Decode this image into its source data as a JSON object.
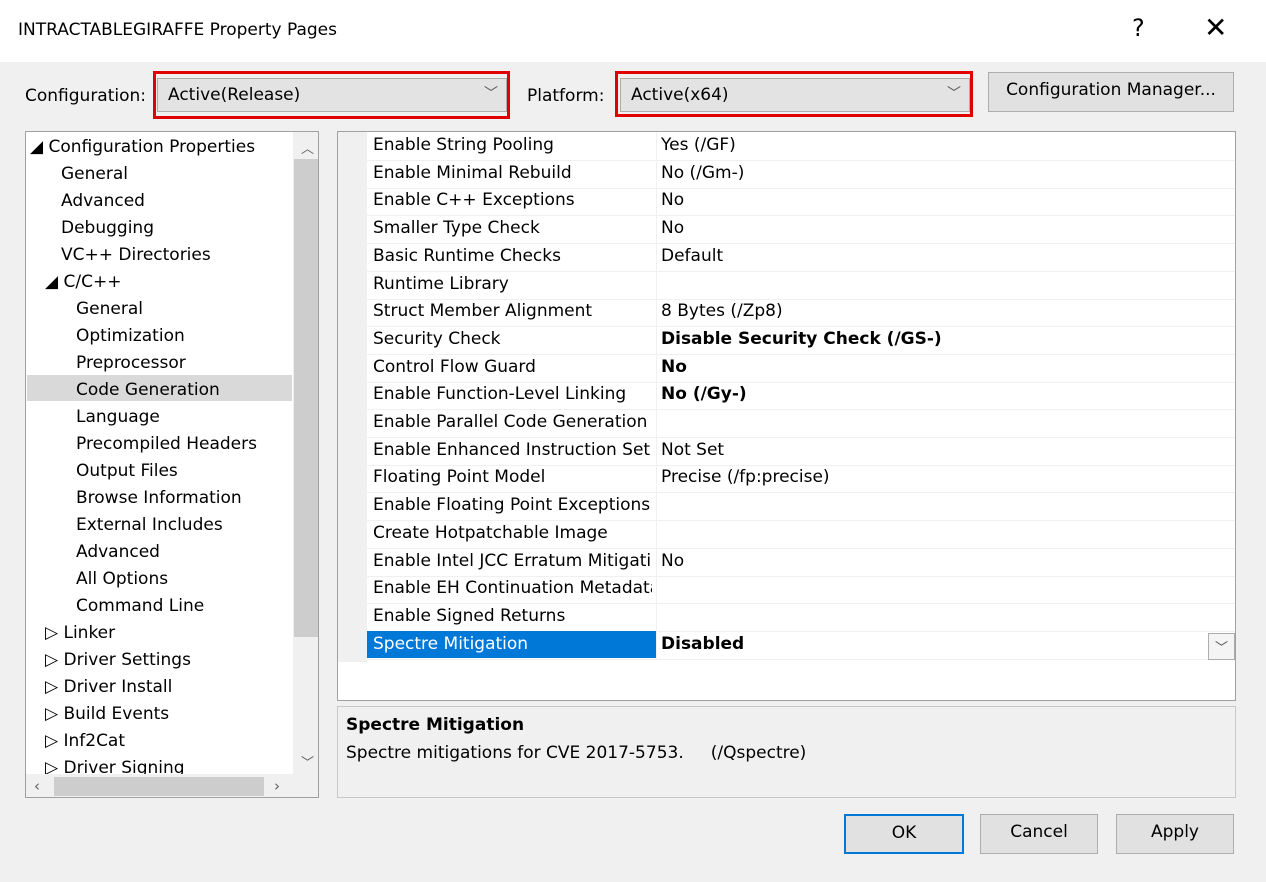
{
  "window": {
    "title": "INTRACTABLEGIRAFFE Property Pages",
    "help_glyph": "?",
    "close_glyph": "✕"
  },
  "toolbar": {
    "configuration_label": "Configuration:",
    "configuration_value": "Active(Release)",
    "platform_label": "Platform:",
    "platform_value": "Active(x64)",
    "configuration_manager_label": "Configuration Manager...",
    "highlight_color": "#e00000"
  },
  "tree": {
    "root": "◢ Configuration Properties",
    "items": [
      "General",
      "Advanced",
      "Debugging",
      "VC++ Directories"
    ],
    "cpp_node": "◢ C/C++",
    "cpp_items": [
      "General",
      "Optimization",
      "Preprocessor",
      "Code Generation",
      "Language",
      "Precompiled Headers",
      "Output Files",
      "Browse Information",
      "External Includes",
      "Advanced",
      "All Options",
      "Command Line"
    ],
    "selected": "Code Generation",
    "collapsed": [
      "▷ Linker",
      "▷ Driver Settings",
      "▷ Driver Install",
      "▷ Build Events",
      "▷ Inf2Cat",
      "▷ Driver Signing"
    ]
  },
  "properties": [
    {
      "name": "Enable String Pooling",
      "value": "Yes (/GF)",
      "bold": false
    },
    {
      "name": "Enable Minimal Rebuild",
      "value": "No (/Gm-)",
      "bold": false
    },
    {
      "name": "Enable C++ Exceptions",
      "value": "No",
      "bold": false
    },
    {
      "name": "Smaller Type Check",
      "value": "No",
      "bold": false
    },
    {
      "name": "Basic Runtime Checks",
      "value": "Default",
      "bold": false
    },
    {
      "name": "Runtime Library",
      "value": "",
      "bold": false
    },
    {
      "name": "Struct Member Alignment",
      "value": "8 Bytes (/Zp8)",
      "bold": false
    },
    {
      "name": "Security Check",
      "value": "Disable Security Check (/GS-)",
      "bold": true
    },
    {
      "name": "Control Flow Guard",
      "value": "No",
      "bold": true
    },
    {
      "name": "Enable Function-Level Linking",
      "value": "No (/Gy-)",
      "bold": true
    },
    {
      "name": "Enable Parallel Code Generation",
      "value": "",
      "bold": false
    },
    {
      "name": "Enable Enhanced Instruction Set",
      "value": "Not Set",
      "bold": false
    },
    {
      "name": "Floating Point Model",
      "value": "Precise (/fp:precise)",
      "bold": false
    },
    {
      "name": "Enable Floating Point Exceptions",
      "value": "",
      "bold": false
    },
    {
      "name": "Create Hotpatchable Image",
      "value": "",
      "bold": false
    },
    {
      "name": "Enable Intel JCC Erratum Mitigation",
      "value": "No",
      "bold": false
    },
    {
      "name": "Enable EH Continuation Metadata",
      "value": "",
      "bold": false
    },
    {
      "name": "Enable Signed Returns",
      "value": "",
      "bold": false
    },
    {
      "name": "Spectre Mitigation",
      "value": "Disabled",
      "bold": true,
      "selected": true
    }
  ],
  "description": {
    "title": "Spectre Mitigation",
    "text": "Spectre mitigations for CVE 2017-5753.     (/Qspectre)"
  },
  "buttons": {
    "ok": "OK",
    "cancel": "Cancel",
    "apply": "Apply"
  },
  "colors": {
    "selection": "#0078d7",
    "ok_border": "#0078d7"
  }
}
